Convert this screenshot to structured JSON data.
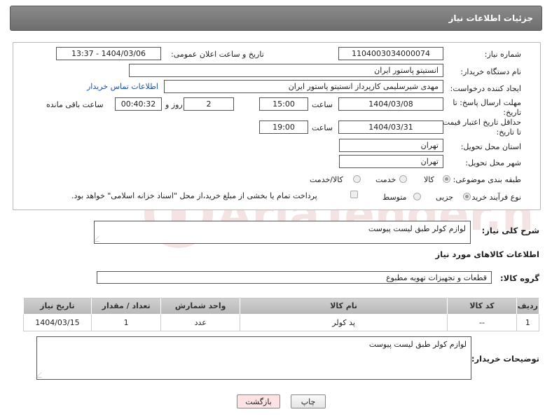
{
  "header": {
    "title": "جزئیات اطلاعات نیاز"
  },
  "form": {
    "need_number": {
      "label": "شماره نیاز:",
      "value": "1104003034000074"
    },
    "announce_datetime": {
      "label": "تاریخ و ساعت اعلان عمومی:",
      "value": "1404/03/06 - 13:37"
    },
    "buyer_org": {
      "label": "نام دستگاه خریدار:",
      "value": "انستیتو پاستور ایران"
    },
    "requester": {
      "label": "ایجاد کننده درخواست:",
      "value": "مهدی شیرسلیمی کارپرداز انستیتو پاستور ایران",
      "contact_link": "اطلاعات تماس خریدار"
    },
    "reply_deadline": {
      "label_line1": "مهلت ارسال پاسخ: تا",
      "label_line2": "تاریخ:",
      "date": "1404/03/08",
      "time_label": "ساعت",
      "time": "15:00",
      "days": "2",
      "days_label": "روز و",
      "remaining": "00:40:32",
      "remaining_label": "ساعت باقی مانده"
    },
    "price_validity": {
      "label_line1": "حداقل تاریخ اعتبار قیمت:",
      "label_line2": "تا تاریخ:",
      "date": "1404/03/31",
      "time_label": "ساعت",
      "time": "19:00"
    },
    "delivery_province": {
      "label": "استان محل تحویل:",
      "value": "تهران"
    },
    "delivery_city": {
      "label": "شهر محل تحویل:",
      "value": "تهران"
    },
    "category": {
      "label": "طبقه بندی موضوعی:",
      "options": [
        "کالا",
        "خدمت",
        "کالا/خدمت"
      ],
      "selected": "کالا"
    },
    "purchase_type": {
      "label": "نوع فرآیند خرید :",
      "options": [
        "جزیی",
        "متوسط"
      ],
      "selected": "جزیی",
      "payment_note": "پرداخت تمام یا بخشی از مبلغ خرید،از محل \"اسناد خزانه اسلامی\" خواهد بود."
    }
  },
  "description": {
    "label": "شرح کلی نیاز:",
    "value": "لوازم کولر طبق لیست پیوست"
  },
  "items_section": {
    "title": "اطلاعات کالاهای مورد نیاز"
  },
  "goods_group": {
    "label": "گروه کالا:",
    "value": "قطعات و تجهیزات تهویه مطبوع"
  },
  "table": {
    "headers": [
      "ردیف",
      "کد کالا",
      "نام کالا",
      "واحد شمارش",
      "تعداد / مقدار",
      "تاریخ نیاز"
    ],
    "rows": [
      [
        "1",
        "--",
        "پد کولر",
        "عدد",
        "1",
        "1404/03/15"
      ]
    ]
  },
  "buyer_notes": {
    "label": "توضیحات خریدار:",
    "value": "لوازم کولر طبق لیست پیوست"
  },
  "buttons": {
    "print": "چاپ",
    "back": "بازگشت"
  },
  "watermark": {
    "text": "AriaTender.net"
  },
  "colors": {
    "header_bg": "#7a7a7a",
    "link": "#1a4fa8",
    "back_button_bg": "#fde3e3",
    "table_header_bg": "#c4c4c4"
  }
}
